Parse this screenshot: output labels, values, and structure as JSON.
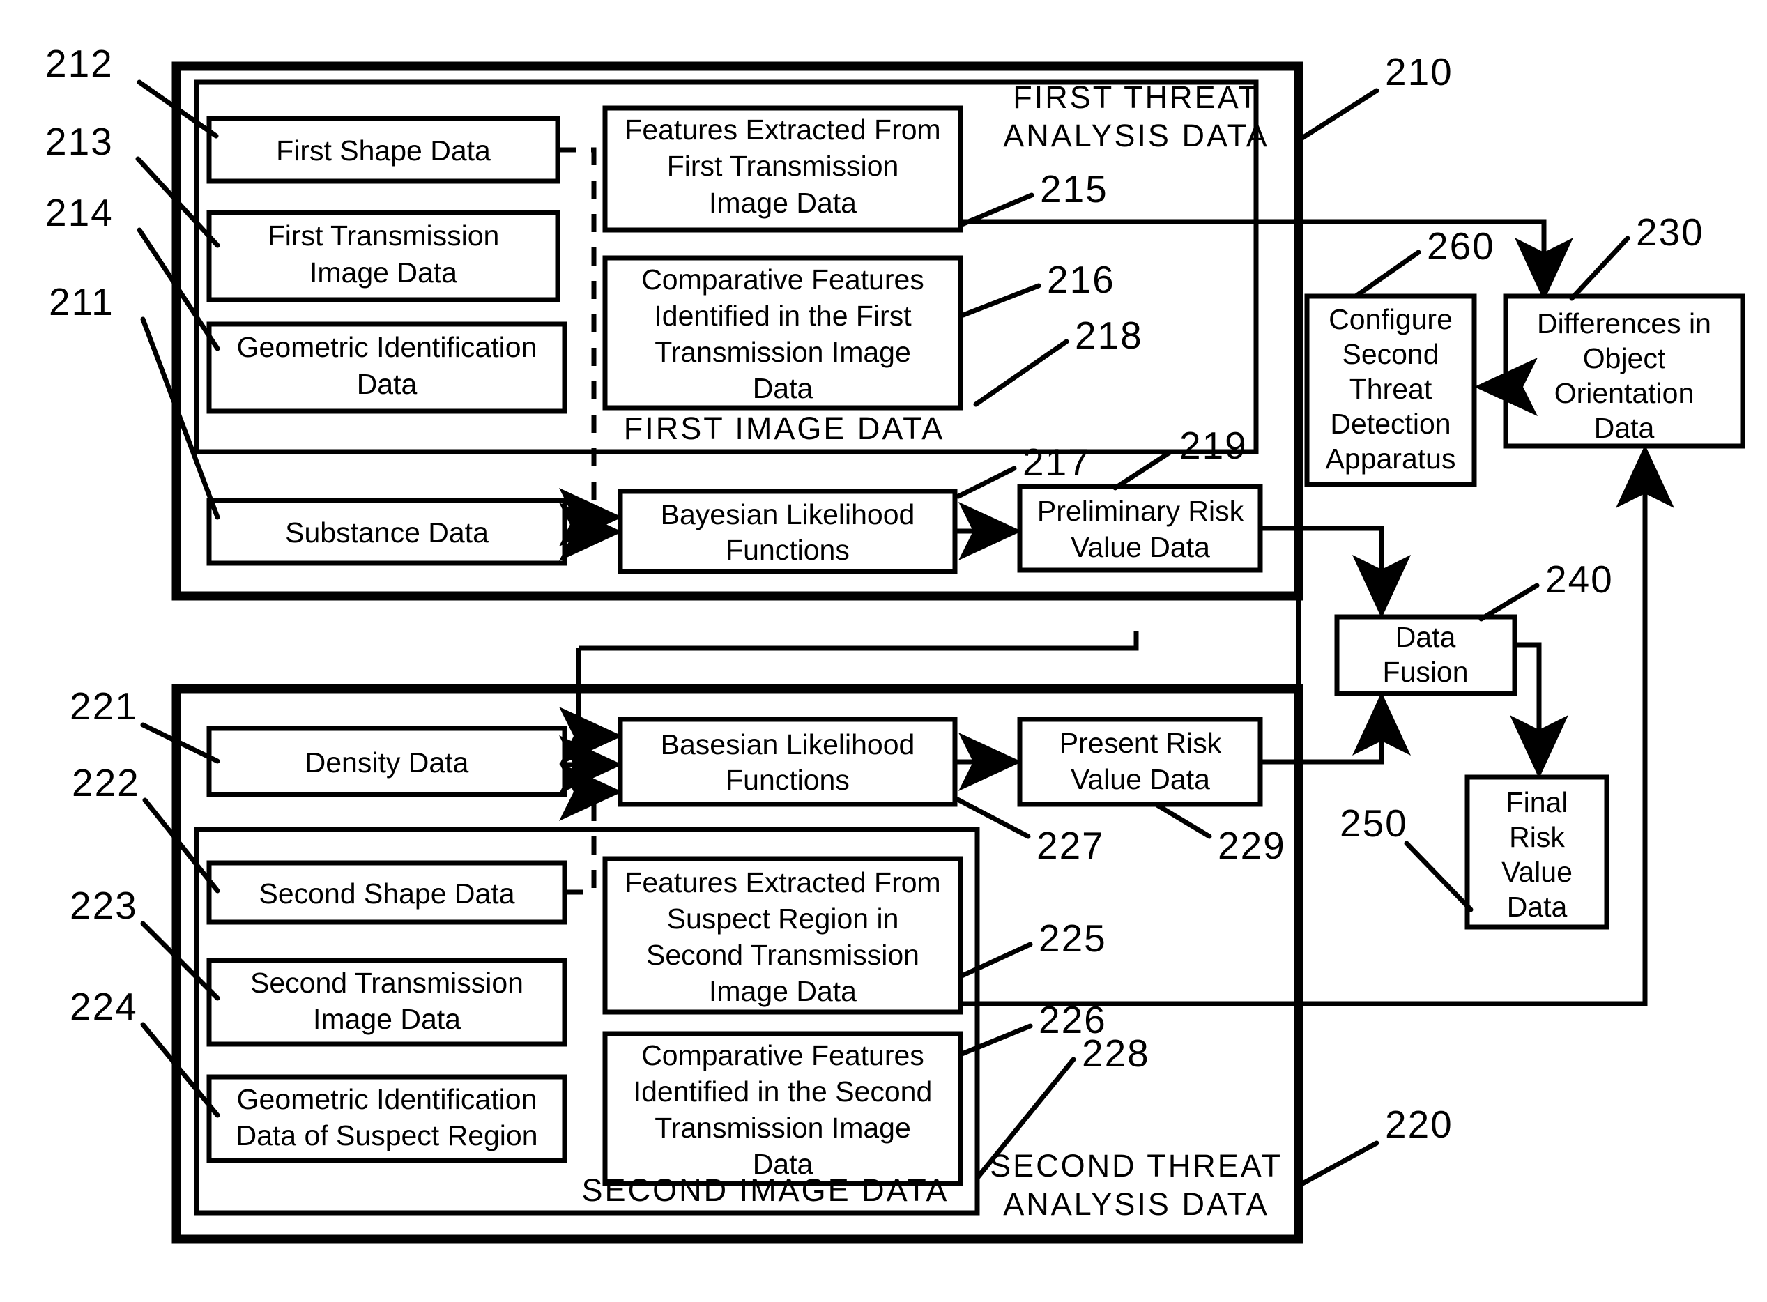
{
  "figure": {
    "type": "patent-block-diagram",
    "background": "#ffffff",
    "line_color": "#000000"
  },
  "panels": {
    "first": {
      "outer_label": "FIRST  THREAT",
      "outer_label_line2": "ANALYSIS  DATA",
      "outer_ref": "210",
      "inner_label": "FIRST   IMAGE   DATA",
      "inner_ref": "218"
    },
    "second": {
      "outer_label": "SECOND  THREAT",
      "outer_label_line2": "ANALYSIS  DATA",
      "outer_ref": "220",
      "inner_label": "SECOND   IMAGE   DATA",
      "inner_ref": "228"
    }
  },
  "boxes": {
    "first_shape_data": {
      "label": "First Shape Data",
      "ref": "212"
    },
    "first_transmission_image_data": {
      "label_l1": "First Transmission",
      "label_l2": "Image Data",
      "ref": "213"
    },
    "geometric_identification_data": {
      "label_l1": "Geometric Identification",
      "label_l2": "Data",
      "ref": "214"
    },
    "substance_data": {
      "label": "Substance Data",
      "ref": "211"
    },
    "features_extracted_first": {
      "label_l1": "Features Extracted From",
      "label_l2": "First Transmission",
      "label_l3": "Image Data",
      "ref": "215"
    },
    "comparative_features_first": {
      "label_l1": "Comparative Features",
      "label_l2": "Identified in the First",
      "label_l3": "Transmission Image",
      "label_l4": "Data",
      "ref": "216"
    },
    "bayesian_likelihood_first": {
      "label_l1": "Bayesian Likelihood",
      "label_l2": "Functions",
      "ref": "217"
    },
    "preliminary_risk_value_data": {
      "label_l1": "Preliminary Risk",
      "label_l2": "Value Data",
      "ref": "219"
    },
    "configure_second_apparatus": {
      "label_l1": "Configure",
      "label_l2": "Second",
      "label_l3": "Threat",
      "label_l4": "Detection",
      "label_l5": "Apparatus",
      "ref": "260"
    },
    "differences_orientation": {
      "label_l1": "Differences in",
      "label_l2": "Object",
      "label_l3": "Orientation",
      "label_l4": "Data",
      "ref": "230"
    },
    "data_fusion": {
      "label_l1": "Data",
      "label_l2": "Fusion",
      "ref": "240"
    },
    "final_risk_value_data": {
      "label_l1": "Final",
      "label_l2": "Risk",
      "label_l3": "Value",
      "label_l4": "Data",
      "ref": "250"
    },
    "density_data": {
      "label": "Density   Data",
      "ref": "221"
    },
    "second_shape_data": {
      "label": "Second   Shape   Data",
      "ref": "222"
    },
    "second_transmission_image_data": {
      "label_l1": "Second Transmission",
      "label_l2": "Image Data",
      "ref": "223"
    },
    "geometric_identification_suspect": {
      "label_l1": "Geometric Identification",
      "label_l2": "Data of Suspect Region",
      "ref": "224"
    },
    "basesian_likelihood_second": {
      "label_l1": "Basesian Likelihood",
      "label_l2": "Functions",
      "ref": "227"
    },
    "features_extracted_second": {
      "label_l1": "Features Extracted From",
      "label_l2": "Suspect Region in",
      "label_l3": "Second Transmission",
      "label_l4": "Image Data",
      "ref": "225"
    },
    "comparative_features_second": {
      "label_l1": "Comparative Features",
      "label_l2": "Identified in the Second",
      "label_l3": "Transmission Image",
      "label_l4": "Data",
      "ref": "226"
    },
    "present_risk_value_data": {
      "label_l1": "Present Risk",
      "label_l2": "Value Data",
      "ref": "229"
    }
  },
  "reference_numerals": [
    "212",
    "213",
    "214",
    "211",
    "215",
    "216",
    "218",
    "217",
    "219",
    "260",
    "230",
    "240",
    "250",
    "221",
    "222",
    "223",
    "224",
    "225",
    "226",
    "227",
    "228",
    "229",
    "210",
    "220"
  ]
}
